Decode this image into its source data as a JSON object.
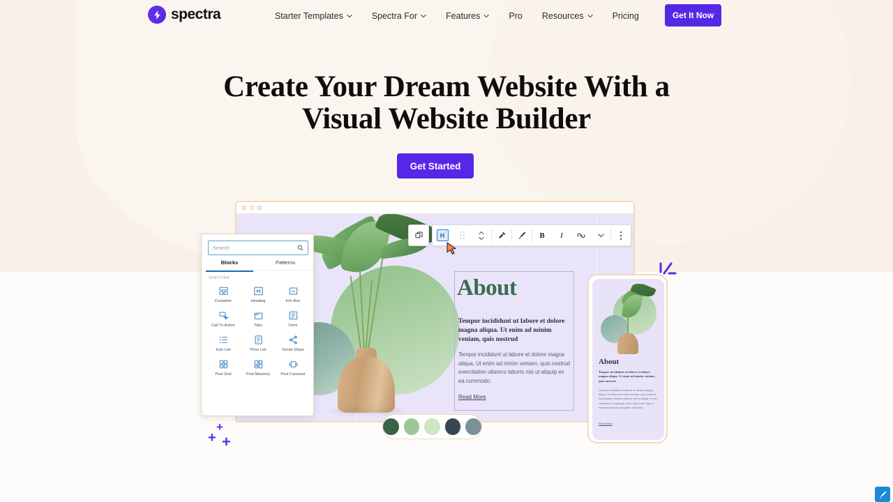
{
  "header": {
    "logo_text": "spectra",
    "logo_icon": "spectra-bolt-icon",
    "nav": [
      {
        "label": "Starter Templates",
        "has_dropdown": true
      },
      {
        "label": "Spectra For",
        "has_dropdown": true
      },
      {
        "label": "Features",
        "has_dropdown": true
      },
      {
        "label": "Pro",
        "has_dropdown": false
      },
      {
        "label": "Resources",
        "has_dropdown": true
      },
      {
        "label": "Pricing",
        "has_dropdown": false
      }
    ],
    "cta_label": "Get It Now"
  },
  "hero": {
    "title_line1": "Create Your Dream Website With a",
    "title_line2": "Visual Website Builder",
    "button_label": "Get Started"
  },
  "mockup": {
    "browser_dots": [
      "red",
      "yellow",
      "blue"
    ],
    "inserter": {
      "search_placeholder": "Search",
      "search_icon": "search-icon",
      "tabs": [
        {
          "label": "Blocks",
          "active": true
        },
        {
          "label": "Patterns",
          "active": false
        }
      ],
      "category": "SPECTRA",
      "blocks": [
        {
          "label": "Container",
          "icon": "container-icon"
        },
        {
          "label": "Heading",
          "icon": "heading-icon"
        },
        {
          "label": "Info Box",
          "icon": "info-box-icon"
        },
        {
          "label": "Call To Action",
          "icon": "call-to-action-icon"
        },
        {
          "label": "Tabs",
          "icon": "tabs-icon"
        },
        {
          "label": "Form",
          "icon": "form-icon"
        },
        {
          "label": "Icon List",
          "icon": "icon-list-icon"
        },
        {
          "label": "Price List",
          "icon": "price-list-icon"
        },
        {
          "label": "Social Share",
          "icon": "social-share-icon"
        },
        {
          "label": "Post Grid",
          "icon": "post-grid-icon"
        },
        {
          "label": "Post Masonry",
          "icon": "post-masonry-icon"
        },
        {
          "label": "Post Carousel",
          "icon": "post-carousel-icon"
        }
      ]
    },
    "toolbar": {
      "buttons": [
        {
          "name": "duplicate-block-icon",
          "label": ""
        },
        {
          "name": "heading-block-icon",
          "label": "H",
          "active": true
        },
        {
          "name": "drag-handle-icon",
          "label": ""
        },
        {
          "name": "move-updown-icon",
          "label": ""
        },
        {
          "name": "transform-icon",
          "label": ""
        },
        {
          "name": "paintbrush-icon",
          "label": ""
        },
        {
          "name": "bold-icon",
          "label": "B"
        },
        {
          "name": "italic-icon",
          "label": "I"
        },
        {
          "name": "link-icon",
          "label": ""
        },
        {
          "name": "chevron-down-icon",
          "label": ""
        },
        {
          "name": "more-options-icon",
          "label": ""
        }
      ]
    },
    "article": {
      "heading": "About",
      "lead": "Tempor incididunt ut labore et dolore magna aliqua. Ut enim ad minim veniam, quis nostrud",
      "body": "Tempor incididunt ut labore et dolore magna aliqua. Ut enim ad minim veniam, quis nostrud exercitation ullamco laboris nisi ut aliquip ex ea commodo.",
      "read_more": "Read More"
    },
    "swatches": [
      "#3C6149",
      "#9CC795",
      "#CFE5C6",
      "#36474F",
      "#7B909B"
    ],
    "phone": {
      "heading": "About",
      "lead": "Tempor incididunt ut labore et dolore magna aliqua. Ut enim ad minim veniam, quis nostrud",
      "body": "Tempor incididunt ut labore et dolore magna aliqua. Ut enim ad minim veniam, quis nostrud exercitation ullamco laboris nisi ut aliquip ex ea commodo consequat. Duis aute irure dolor in reprehenderit in voluptate velit esse.",
      "read_more": "Read More"
    }
  },
  "decor": {
    "plus_marks": [
      "+",
      "+",
      "+"
    ],
    "sparkle": "sparkle-lines",
    "corner_badge_icon": "paintbrush-icon"
  },
  "colors": {
    "accent_purple": "#5627E6",
    "bg_beige": "#F9F1E9",
    "bg_white": "#FDFCFA",
    "canvas_lavender": "#EAE4FA",
    "frame_tan": "#F2D9B8",
    "about_green": "#3B6B4E"
  }
}
